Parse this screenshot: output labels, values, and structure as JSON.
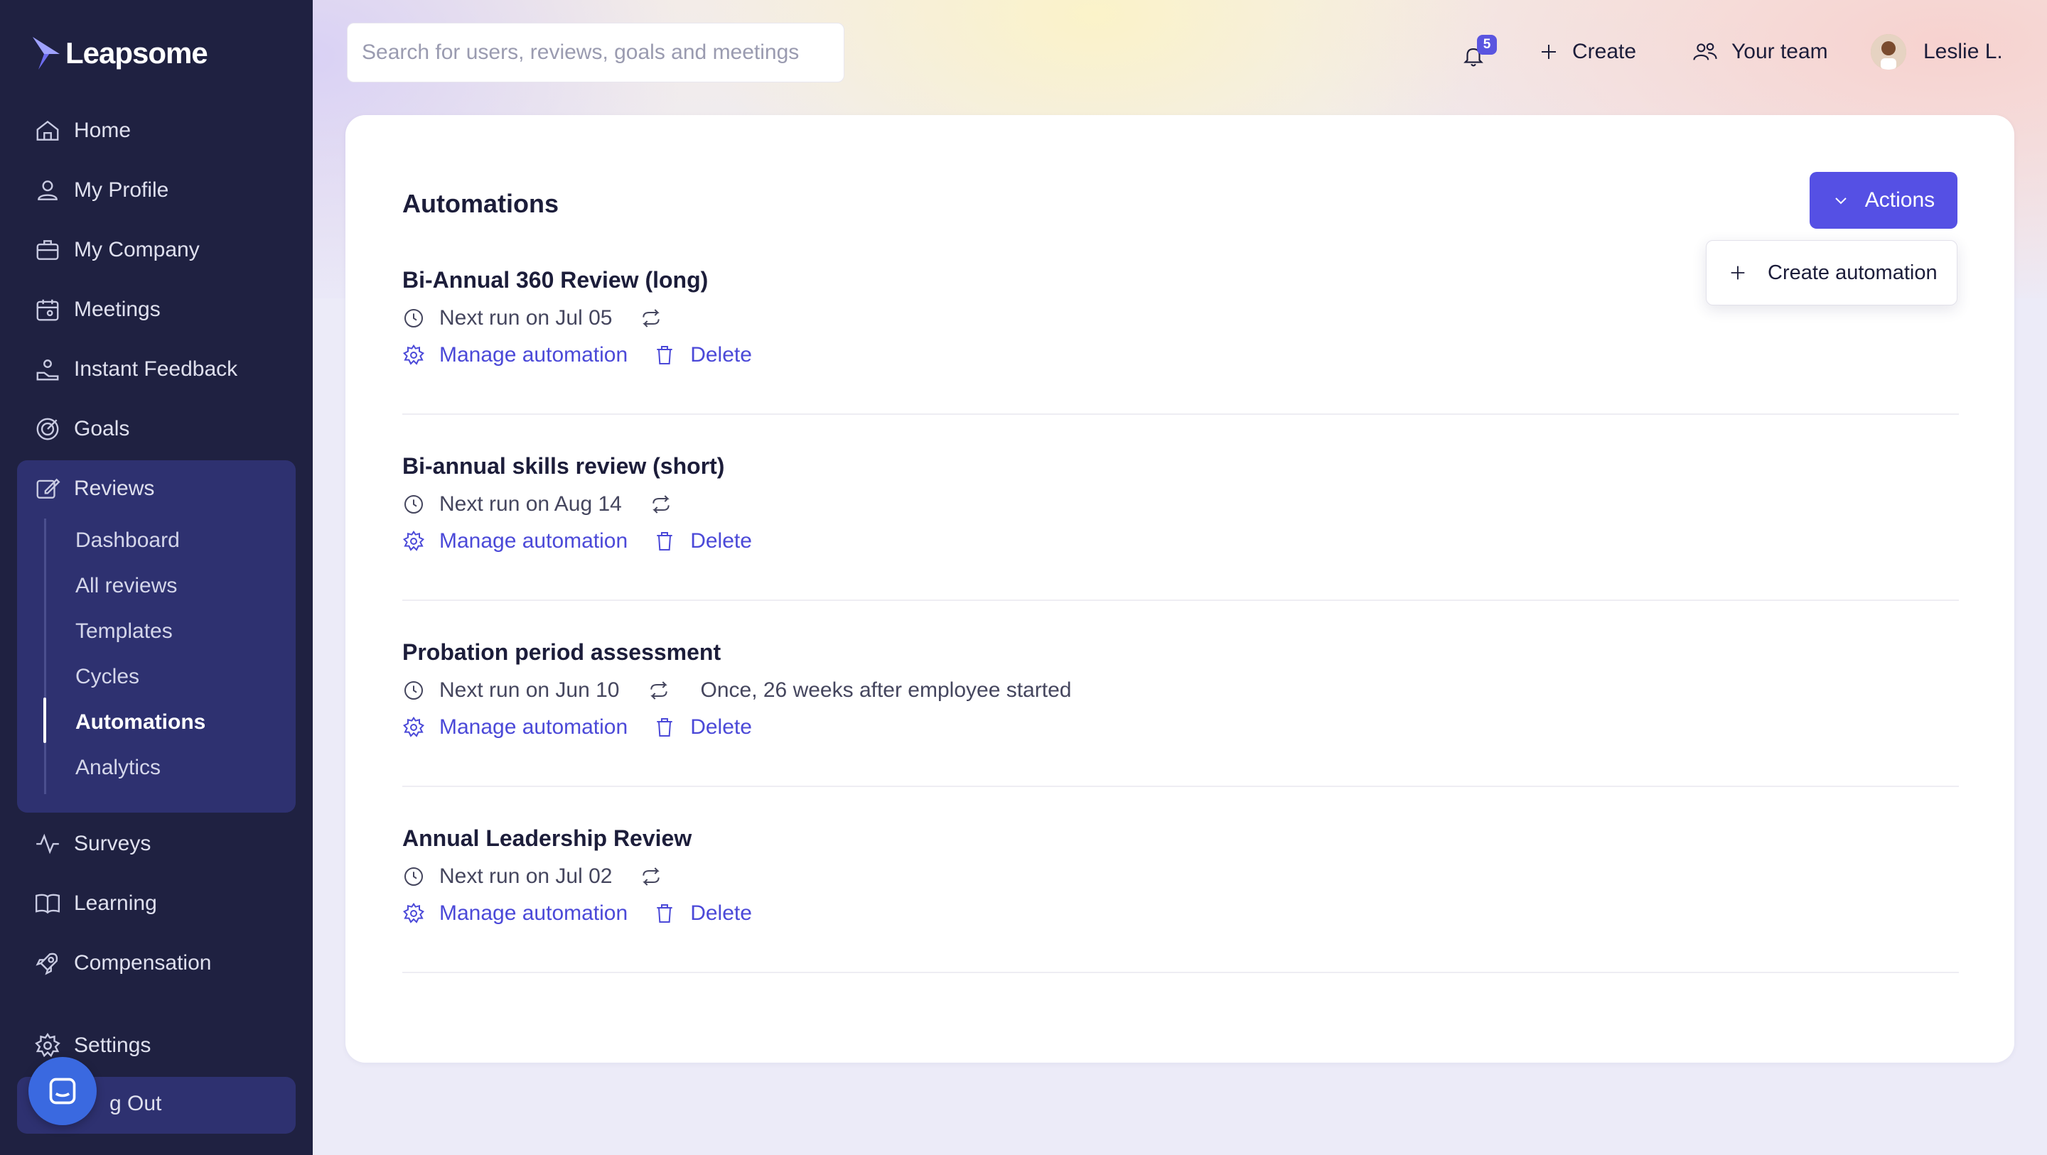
{
  "app": {
    "name": "Leapsome"
  },
  "search": {
    "placeholder": "Search for users, reviews, goals and meetings"
  },
  "header": {
    "notifications_count": "5",
    "create_label": "Create",
    "team_label": "Your team",
    "user_name": "Leslie L."
  },
  "sidebar": {
    "items": [
      {
        "label": "Home",
        "icon": "home-icon"
      },
      {
        "label": "My Profile",
        "icon": "user-icon"
      },
      {
        "label": "My Company",
        "icon": "briefcase-icon"
      },
      {
        "label": "Meetings",
        "icon": "calendar-icon"
      },
      {
        "label": "Instant Feedback",
        "icon": "feedback-icon"
      },
      {
        "label": "Goals",
        "icon": "target-icon"
      },
      {
        "label": "Reviews",
        "icon": "edit-icon"
      },
      {
        "label": "Surveys",
        "icon": "pulse-icon"
      },
      {
        "label": "Learning",
        "icon": "book-icon"
      },
      {
        "label": "Compensation",
        "icon": "rocket-icon"
      },
      {
        "label": "Settings",
        "icon": "gear-icon"
      },
      {
        "label": "g Out",
        "icon": "logout-icon"
      }
    ],
    "reviews_sub": [
      {
        "label": "Dashboard"
      },
      {
        "label": "All reviews"
      },
      {
        "label": "Templates"
      },
      {
        "label": "Cycles"
      },
      {
        "label": "Automations",
        "active": true
      },
      {
        "label": "Analytics"
      }
    ]
  },
  "main": {
    "title": "Automations",
    "actions_label": "Actions",
    "dropdown": {
      "create_label": "Create automation"
    },
    "manage_label": "Manage automation",
    "delete_label": "Delete",
    "automations": [
      {
        "name": "Bi-Annual 360 Review (long)",
        "next_run": "Next run on Jul 05",
        "schedule": ""
      },
      {
        "name": "Bi-annual skills review (short)",
        "next_run": "Next run on Aug 14",
        "schedule": ""
      },
      {
        "name": "Probation period assessment",
        "next_run": "Next run on Jun 10",
        "schedule": "Once, 26 weeks after employee started"
      },
      {
        "name": "Annual Leadership Review",
        "next_run": "Next run on Jul 02",
        "schedule": ""
      }
    ]
  },
  "colors": {
    "sidebar_bg": "#1f2141",
    "sidebar_active_group": "#2e3170",
    "accent": "#5550e4",
    "link": "#4b49d8",
    "chat": "#3a69e0"
  }
}
